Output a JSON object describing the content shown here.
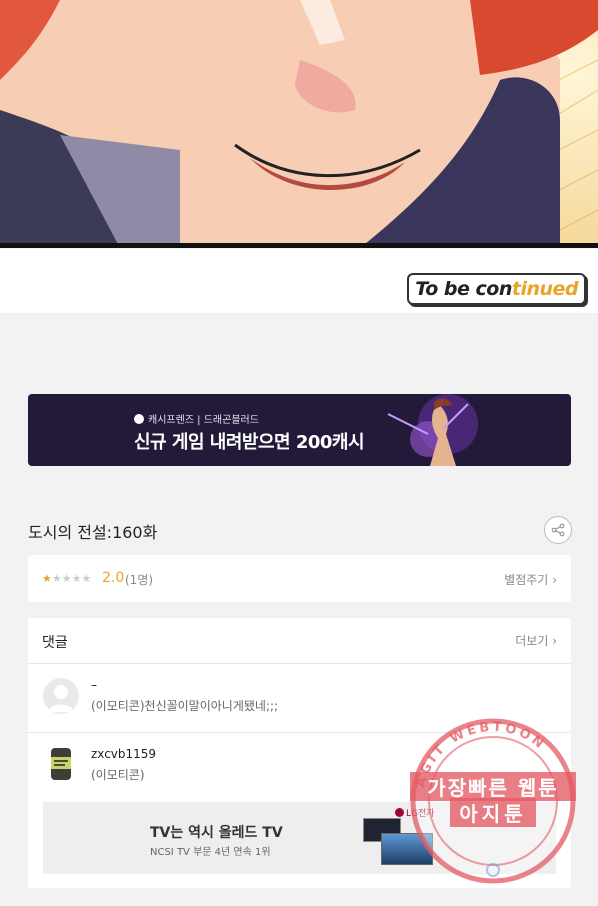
{
  "comic": {
    "end_banner": {
      "part1": "To be con",
      "part2": "tinued"
    }
  },
  "ad_banner": {
    "brand": "캐시프렌즈 | 드래곤블러드",
    "headline": "신규 게임 내려받으면 200캐시"
  },
  "episode": {
    "title": "도시의 전설:160화"
  },
  "rating": {
    "value": "2.0",
    "count": "(1명)",
    "rate_link": "별점주기",
    "stars_filled": 1,
    "stars_total": 5
  },
  "comments": {
    "title": "댓글",
    "more_link": "더보기",
    "items": [
      {
        "name": "–",
        "text": "(이모티콘)천신꼴이말이아니게됐네;;;"
      },
      {
        "name": "zxcvb1159",
        "text": "(이모티콘)"
      }
    ]
  },
  "inline_ad": {
    "title": "TV는 역시 올레드 TV",
    "subtitle": "NCSI TV 부문 4년 연속 1위",
    "brand": "LG전자"
  },
  "watermark": {
    "ring_text": "AGIT WEBTOON",
    "line1": "가장빠른 웹툰",
    "line2": "아지툰"
  },
  "colors": {
    "accent": "#e7a52a",
    "banner_bg": "#231a39",
    "stamp": "#e45a64"
  }
}
